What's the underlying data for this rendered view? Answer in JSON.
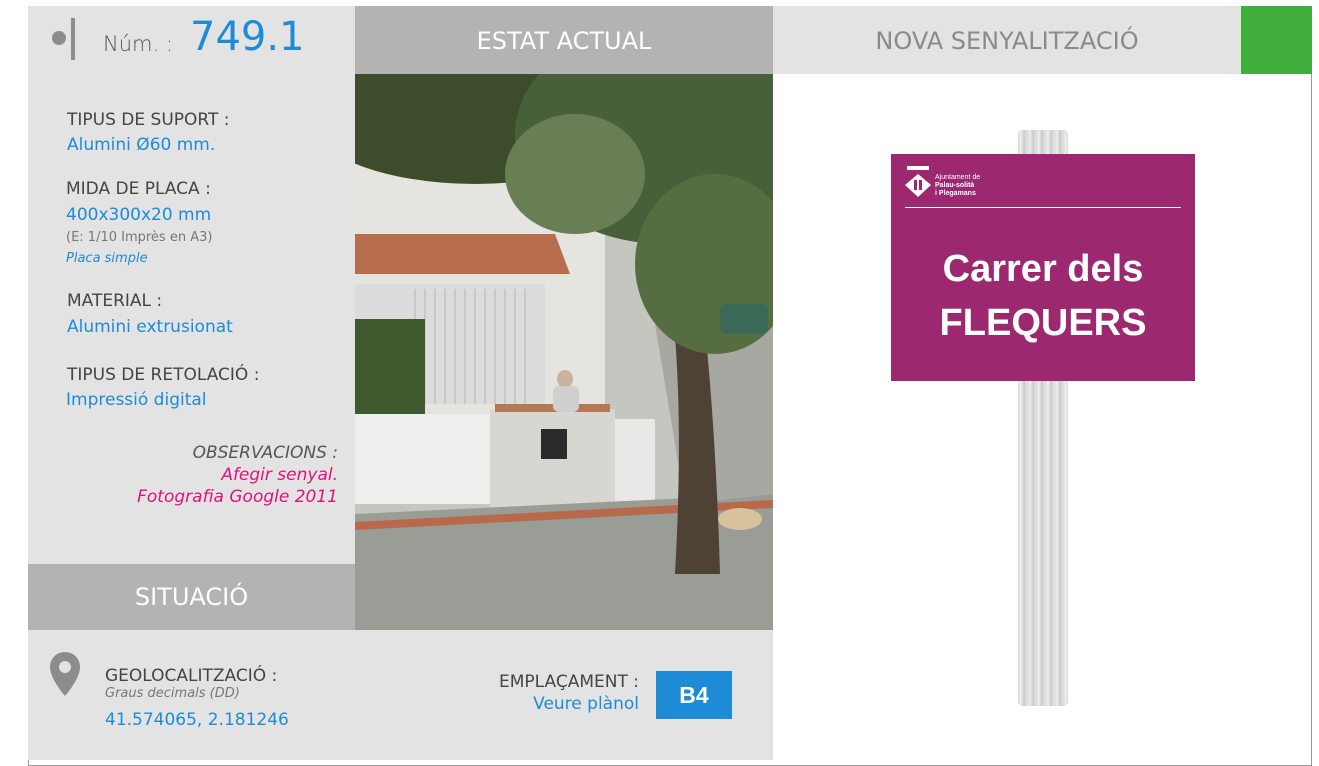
{
  "header": {
    "num_label": "Núm. :",
    "num_value": "749.1",
    "current_state": "ESTAT ACTUAL",
    "new_signage": "NOVA SENYALITZACIÓ"
  },
  "specs": {
    "support_label": "TIPUS DE SUPORT :",
    "support_value": "Alumini Ø60 mm.",
    "plate_size_label": "MIDA DE PLACA :",
    "plate_size_value": "400x300x20 mm",
    "scale_note": "(E: 1/10 Imprès en A3)",
    "plate_type": "Placa simple",
    "material_label": "MATERIAL :",
    "material_value": "Alumini extrusionat",
    "lettering_label": "TIPUS DE RETOLACIÓ :",
    "lettering_value": "Impressió digital"
  },
  "observations": {
    "label": "OBSERVACIONS :",
    "line1": "Afegir senyal.",
    "line2": "Fotografia Google 2011"
  },
  "situation": {
    "title": "SITUACIÓ",
    "geo_label": "GEOLOCALITZACIÓ :",
    "geo_format": "Graus decimals (DD)",
    "coordinates": "41.574065, 2.181246",
    "placement_label": "EMPLAÇAMENT :",
    "placement_link": "Veure plànol",
    "placement_code": "B4"
  },
  "sign": {
    "municipality_line1": "Ajuntament de",
    "municipality_line2": "Palau-solità",
    "municipality_line3": "i Plegamans",
    "street_line1": "Carrer dels",
    "street_line2": "FLEQUERS"
  },
  "colors": {
    "accent_blue": "#1d8bd6",
    "magenta_note": "#e0117f",
    "sign_plate": "#9c2870",
    "status_green": "#3fae3b"
  }
}
